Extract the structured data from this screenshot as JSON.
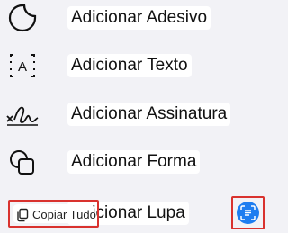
{
  "menu": {
    "items": [
      {
        "label": "Adicionar Adesivo",
        "icon": "sticker-icon"
      },
      {
        "label": "Adicionar Texto",
        "icon": "text-box-icon"
      },
      {
        "label": "Adicionar Assinatura",
        "icon": "signature-icon"
      },
      {
        "label": "Adicionar Forma",
        "icon": "shapes-icon"
      },
      {
        "label": "Adicionar Lupa",
        "icon": "magnifier-icon"
      }
    ]
  },
  "copy_button": {
    "label": "Copiar Tudo",
    "icon": "copy-icon"
  },
  "live_text_button": {
    "icon": "live-text-scan-icon",
    "color": "#1e7df0"
  },
  "highlight_color": "#d9322e"
}
